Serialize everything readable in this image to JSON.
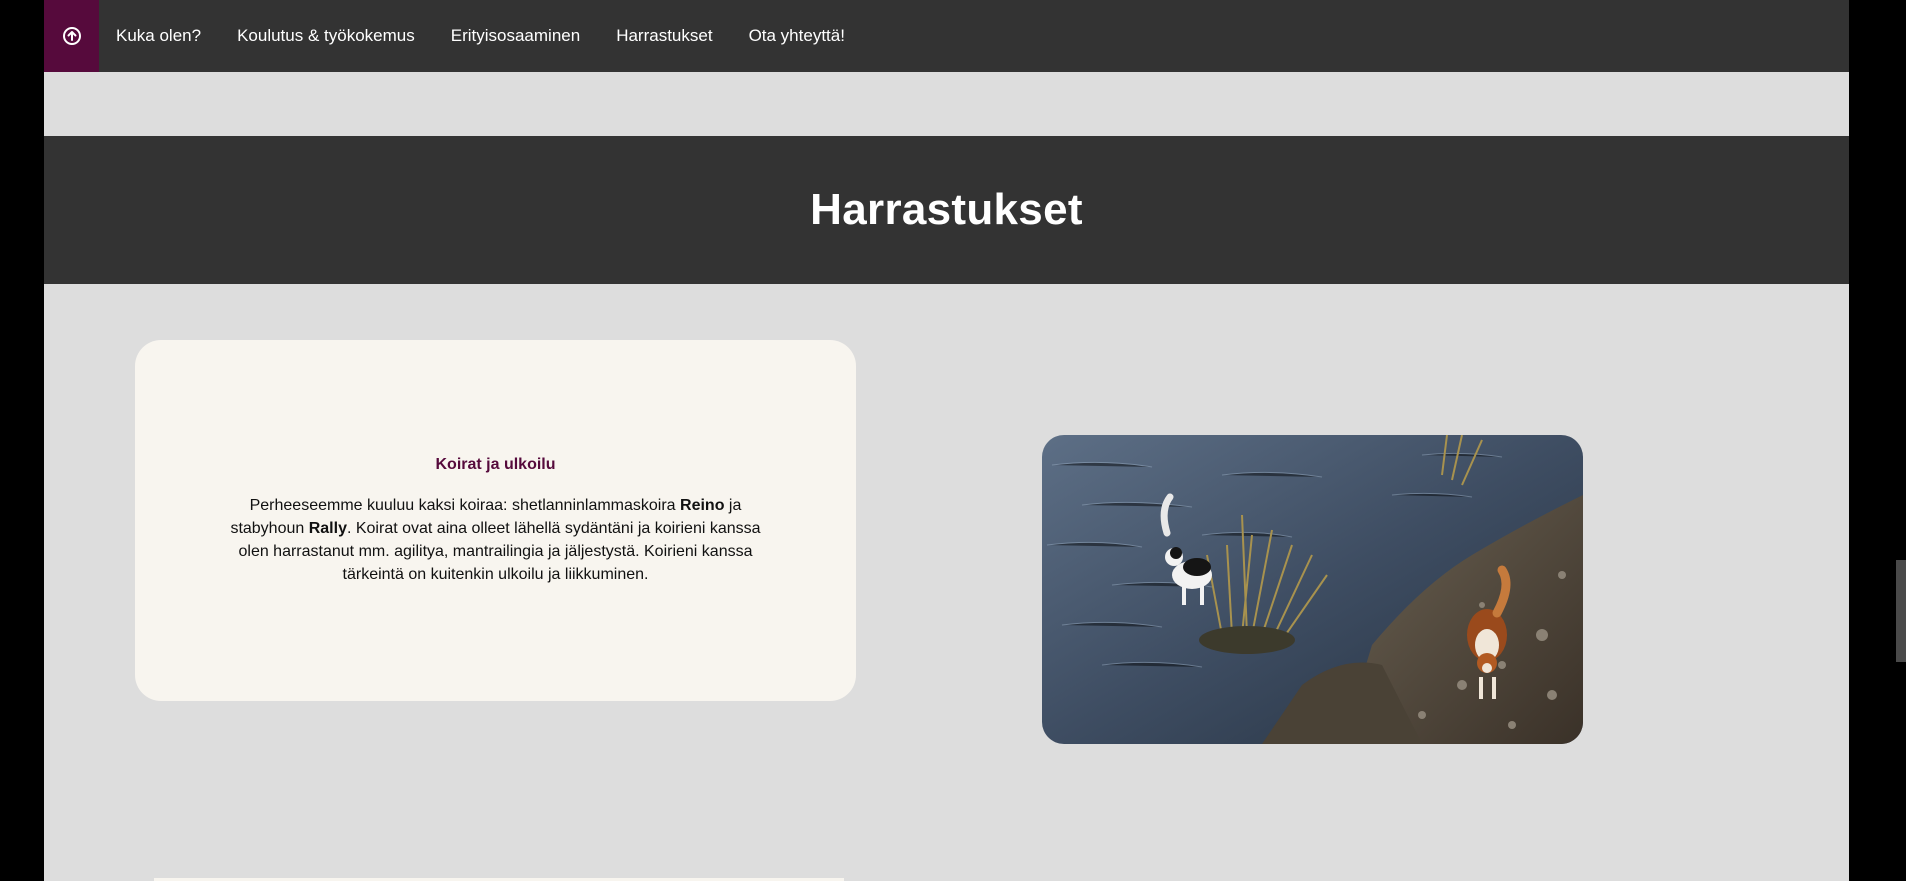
{
  "nav": {
    "home_icon": "arrow-up-circle-icon",
    "links": [
      "Kuka olen?",
      "Koulutus & työkokemus",
      "Erityisosaaminen",
      "Harrastukset",
      "Ota yhteyttä!"
    ]
  },
  "section": {
    "title": "Harrastukset"
  },
  "card": {
    "title": "Koirat ja ulkoilu",
    "text_parts": {
      "p1": "Perheeseemme kuuluu kaksi koiraa: shetlanninlammaskoira ",
      "dog1": "Reino",
      "p2": " ja stabyhoun ",
      "dog2": "Rally",
      "p3": ". Koirat ovat aina olleet lähellä sydäntäni ja koirieni kanssa olen harrastanut mm. agilitya, mantrailingia ja jäljestystä. Koirieni kanssa tärkeintä on kuitenkin ulkoilu ja liikkuminen."
    }
  },
  "colors": {
    "nav_bg": "#333333",
    "accent": "#560a3c",
    "page_bg": "#dddddd",
    "card_bg": "#f8f5ef"
  }
}
